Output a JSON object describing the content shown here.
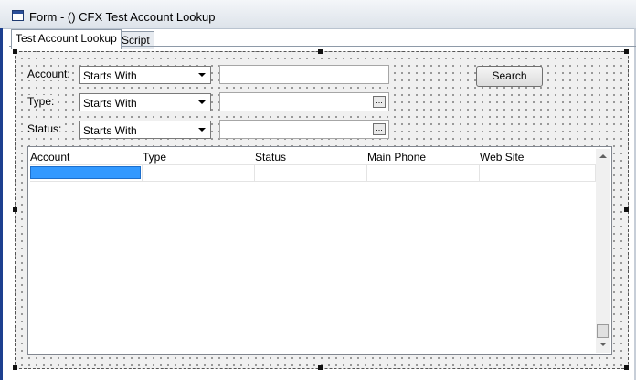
{
  "window": {
    "title": "Form - () CFX Test Account Lookup"
  },
  "tabs": [
    {
      "label": "Test Account Lookup"
    },
    {
      "label": "Script"
    }
  ],
  "filters": [
    {
      "label": "Account:",
      "operator": "Starts With",
      "value": "",
      "has_lookup": false
    },
    {
      "label": "Type:",
      "operator": "Starts With",
      "value": "",
      "has_lookup": true,
      "lookup_label": "..."
    },
    {
      "label": "Status:",
      "operator": "Starts With",
      "value": "",
      "has_lookup": true,
      "lookup_label": "..."
    }
  ],
  "search_button": {
    "label": "Search"
  },
  "grid": {
    "columns": [
      "Account",
      "Type",
      "Status",
      "Main Phone",
      "Web Site"
    ],
    "selected_cell_color": "#3399ff"
  }
}
